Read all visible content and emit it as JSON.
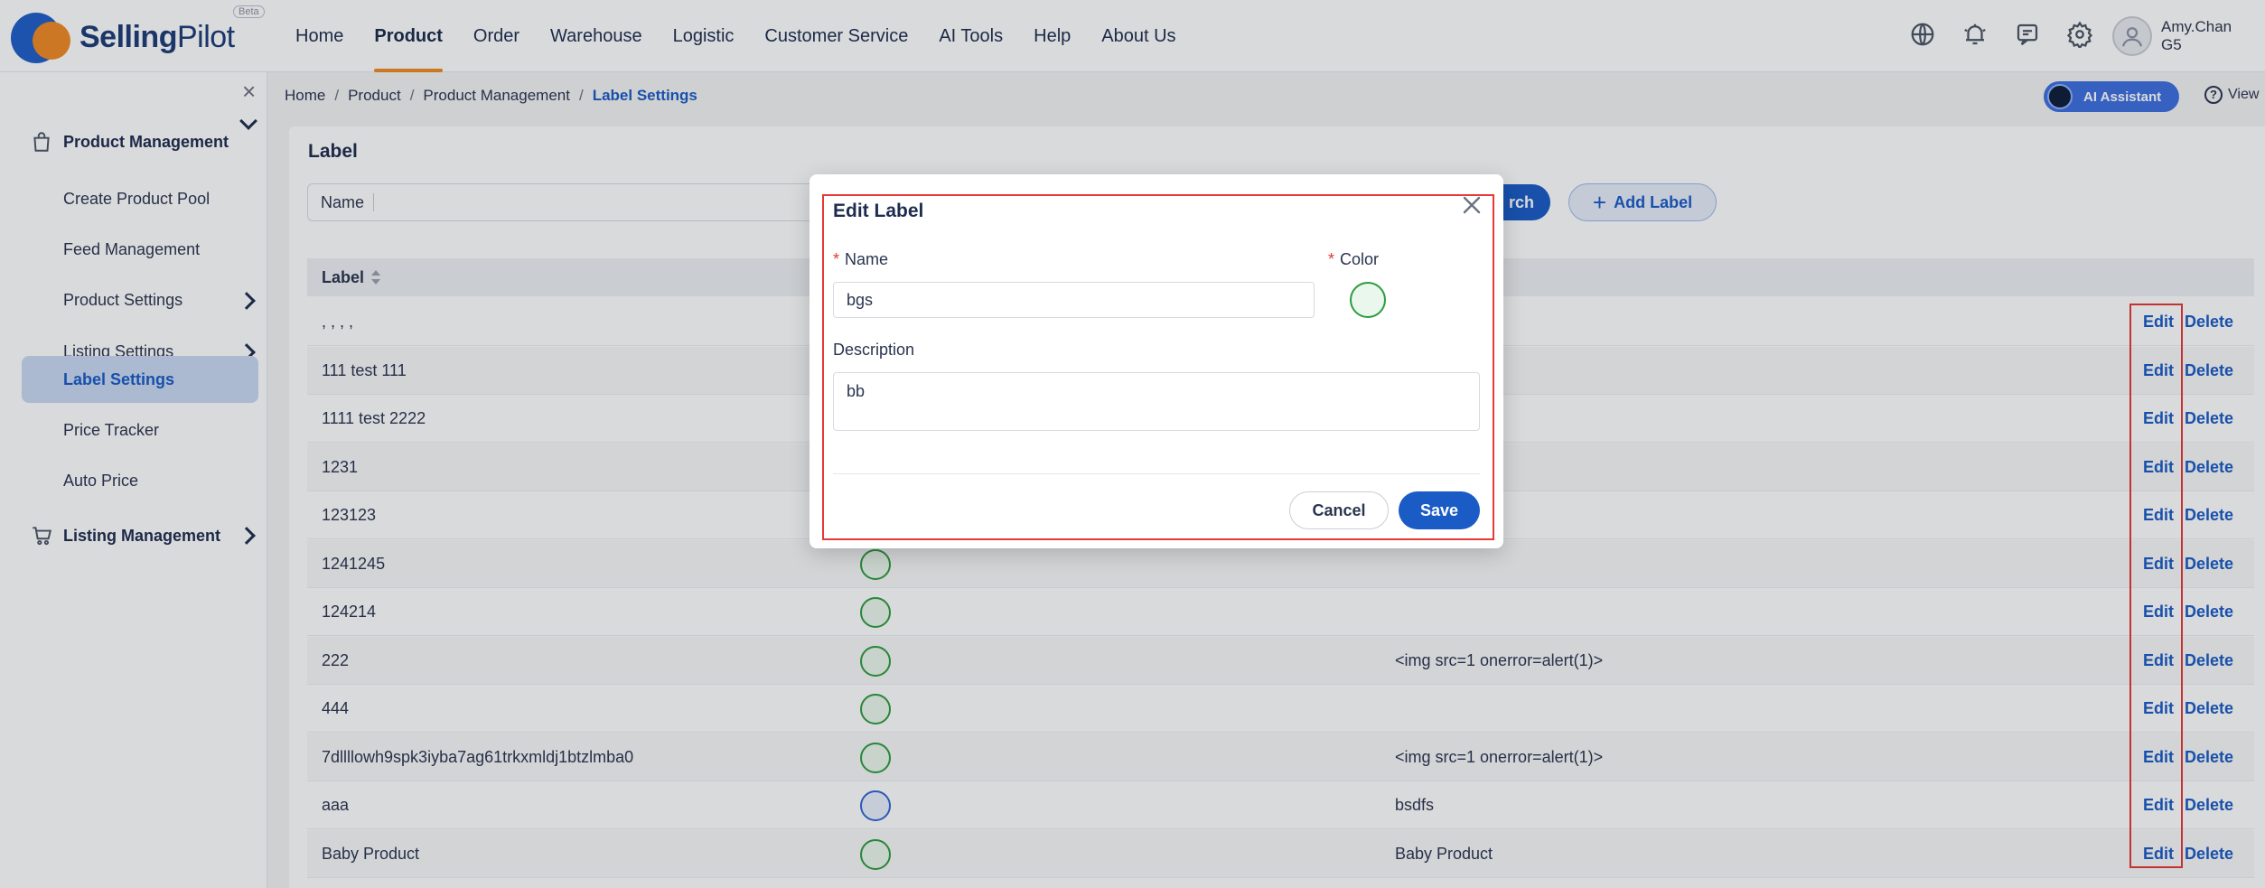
{
  "brand": {
    "name_bold": "Selling",
    "name_light": "Pilot",
    "badge": "Beta"
  },
  "nav": {
    "items": [
      {
        "label": "Home"
      },
      {
        "label": "Product"
      },
      {
        "label": "Order"
      },
      {
        "label": "Warehouse"
      },
      {
        "label": "Logistic"
      },
      {
        "label": "Customer Service"
      },
      {
        "label": "AI Tools"
      },
      {
        "label": "Help"
      },
      {
        "label": "About Us"
      }
    ],
    "active": "Product",
    "icons": [
      "globe-icon",
      "bell-icon",
      "chat-icon",
      "gear-icon"
    ]
  },
  "user": {
    "name": "Amy.Chan",
    "code": "G5"
  },
  "sidebar": {
    "groups": [
      {
        "label": "Product Management",
        "icon": "bag-icon"
      },
      {
        "label": "Listing Management",
        "icon": "cart-icon"
      }
    ],
    "items": [
      {
        "label": "Create Product Pool"
      },
      {
        "label": "Feed Management"
      },
      {
        "label": "Product Settings"
      },
      {
        "label": "Listing Settings"
      },
      {
        "label": "Label Settings"
      },
      {
        "label": "Price Tracker"
      },
      {
        "label": "Auto Price"
      }
    ]
  },
  "breadcrumb": {
    "items": [
      "Home",
      "Product",
      "Product Management"
    ],
    "current": "Label Settings"
  },
  "ai_assistant": {
    "label": "AI Assistant"
  },
  "view": {
    "label": "View"
  },
  "page": {
    "title": "Label",
    "filter_label": "Name",
    "search_label": "rch",
    "add_label": "Add Label"
  },
  "table": {
    "header_label": "Label",
    "edit_text": "Edit",
    "delete_text": "Delete",
    "rows": [
      {
        "name": ", , , ,",
        "color": "#2e9b3f",
        "description": ""
      },
      {
        "name": "111 test 111",
        "color": "#2e9b3f",
        "description": ""
      },
      {
        "name": "1111 test 2222",
        "color": "#2e9b3f",
        "description": ""
      },
      {
        "name": "1231",
        "color": "#2e9b3f",
        "description": ""
      },
      {
        "name": "123123",
        "color": "#2e9b3f",
        "description": ""
      },
      {
        "name": "1241245",
        "color": "#2e9b3f",
        "description": ""
      },
      {
        "name": "124214",
        "color": "#2e9b3f",
        "description": ""
      },
      {
        "name": "222",
        "color": "#2e9b3f",
        "description": "<img src=1 onerror=alert(1)>"
      },
      {
        "name": "444",
        "color": "#2e9b3f",
        "description": ""
      },
      {
        "name": "7dllllowh9spk3iyba7ag61trkxmldj1btzlmba0",
        "color": "#2e9b3f",
        "description": "<img src=1 onerror=alert(1)>"
      },
      {
        "name": "aaa",
        "color": "#2f66d6",
        "description": "bsdfs"
      },
      {
        "name": "Baby Product",
        "color": "#2e9b3f",
        "description": "Baby Product"
      }
    ]
  },
  "modal": {
    "title": "Edit Label",
    "name_label": "Name",
    "name_value": "bgs",
    "color_label": "Color",
    "color_value": "#2e9b3f",
    "description_label": "Description",
    "description_value": "bb",
    "cancel_label": "Cancel",
    "save_label": "Save"
  }
}
